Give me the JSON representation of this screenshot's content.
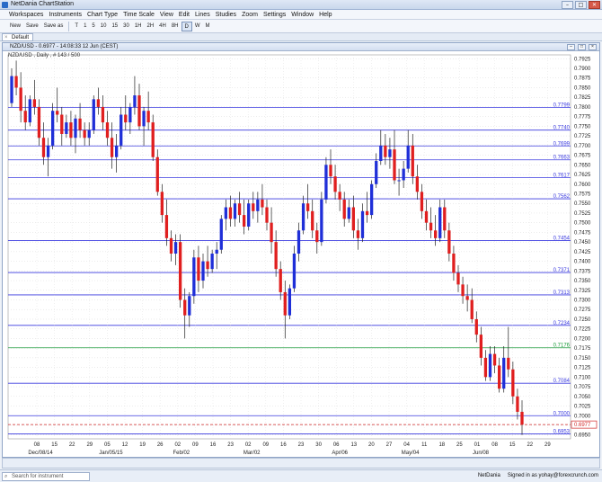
{
  "window": {
    "title": "NetDania ChartStation"
  },
  "menu": [
    "Workspaces",
    "Instruments",
    "Chart Type",
    "Time Scale",
    "View",
    "Edit",
    "Lines",
    "Studies",
    "Zoom",
    "Settings",
    "Window",
    "Help"
  ],
  "toolbar": {
    "buttons": [
      "New",
      "Save",
      "Save as"
    ],
    "timescales": [
      "T",
      "1",
      "5",
      "10",
      "15",
      "30",
      "1H",
      "2H",
      "4H",
      "8H",
      "D",
      "W",
      "M"
    ],
    "selected_timescale": "D"
  },
  "tab": {
    "label": "Default"
  },
  "chart_window": {
    "title": "NZD/USD - 0.6977 - 14:08:33 12 Jun (CEST)",
    "subtitle": "NZD/USD , Daily , # 143 / 500"
  },
  "chart_data": {
    "type": "candlestick",
    "instrument": "NZD/USD",
    "ylim": [
      0.694,
      0.7935
    ],
    "y_ticks": [
      "0.7925",
      "0.7900",
      "0.7875",
      "0.7850",
      "0.7825",
      "0.7800",
      "0.7775",
      "0.7750",
      "0.7725",
      "0.7700",
      "0.7675",
      "0.7650",
      "0.7625",
      "0.7600",
      "0.7575",
      "0.7550",
      "0.7525",
      "0.7500",
      "0.7475",
      "0.7450",
      "0.7425",
      "0.7400",
      "0.7375",
      "0.7350",
      "0.7325",
      "0.7300",
      "0.7275",
      "0.7250",
      "0.7225",
      "0.7200",
      "0.7175",
      "0.7150",
      "0.7125",
      "0.7100",
      "0.7075",
      "0.7050",
      "0.7025",
      "0.7000",
      "0.6975",
      "0.6950"
    ],
    "x_ticks": [
      "08",
      "15",
      "22",
      "29",
      "05",
      "12",
      "19",
      "26",
      "02",
      "09",
      "16",
      "23",
      "02",
      "09",
      "16",
      "23",
      "30",
      "06",
      "13",
      "20",
      "27",
      "04",
      "11",
      "18",
      "25",
      "01",
      "08",
      "15",
      "22",
      "29"
    ],
    "x_month_labels": [
      {
        "after_tick": 0,
        "label": "Dec/08/14"
      },
      {
        "after_tick": 4,
        "label": "Jan/05/15"
      },
      {
        "after_tick": 8,
        "label": "Feb/02"
      },
      {
        "after_tick": 12,
        "label": "Mar/02"
      },
      {
        "after_tick": 17,
        "label": "Apr/06"
      },
      {
        "after_tick": 21,
        "label": "May/04"
      },
      {
        "after_tick": 25,
        "label": "Jun/08"
      }
    ],
    "h_lines": [
      {
        "value": 0.7799,
        "label": "0.7799",
        "color": "#3a3adf"
      },
      {
        "value": 0.774,
        "label": "0.7740",
        "color": "#3a3adf"
      },
      {
        "value": 0.7699,
        "label": "0.7699",
        "color": "#3a3adf"
      },
      {
        "value": 0.7663,
        "label": "0.7663",
        "color": "#3a3adf"
      },
      {
        "value": 0.7617,
        "label": "0.7617",
        "color": "#3a3adf"
      },
      {
        "value": 0.7562,
        "label": "0.7562",
        "color": "#3a3adf"
      },
      {
        "value": 0.7454,
        "label": "0.7454",
        "color": "#3a3adf"
      },
      {
        "value": 0.7371,
        "label": "0.7371",
        "color": "#3a3adf"
      },
      {
        "value": 0.7313,
        "label": "0.7313",
        "color": "#3a3adf"
      },
      {
        "value": 0.7234,
        "label": "0.7234",
        "color": "#3a3adf"
      },
      {
        "value": 0.7176,
        "label": "0.7176",
        "color": "#1a9a3a"
      },
      {
        "value": 0.7084,
        "label": "0.7084",
        "color": "#3a3adf"
      },
      {
        "value": 0.7,
        "label": "0.7000",
        "color": "#3a3adf"
      },
      {
        "value": 0.6953,
        "label": "0.6953",
        "color": "#3a3adf"
      }
    ],
    "last_price": {
      "value": 0.6977,
      "label": "0.6977",
      "color": "#d22a2a"
    },
    "colors": {
      "up": "#1f2fd8",
      "down": "#e01f1f",
      "grid": "#d9d9d9",
      "background": "#ffffff"
    },
    "candles": [
      [
        0.781,
        0.79,
        0.78,
        0.788
      ],
      [
        0.788,
        0.792,
        0.783,
        0.785
      ],
      [
        0.785,
        0.789,
        0.776,
        0.779
      ],
      [
        0.779,
        0.783,
        0.774,
        0.776
      ],
      [
        0.776,
        0.783,
        0.775,
        0.782
      ],
      [
        0.782,
        0.787,
        0.778,
        0.78
      ],
      [
        0.78,
        0.782,
        0.77,
        0.772
      ],
      [
        0.772,
        0.776,
        0.765,
        0.767
      ],
      [
        0.767,
        0.772,
        0.762,
        0.77
      ],
      [
        0.77,
        0.781,
        0.769,
        0.779
      ],
      [
        0.779,
        0.785,
        0.776,
        0.778
      ],
      [
        0.778,
        0.78,
        0.77,
        0.773
      ],
      [
        0.773,
        0.778,
        0.772,
        0.776
      ],
      [
        0.776,
        0.779,
        0.77,
        0.772
      ],
      [
        0.772,
        0.778,
        0.768,
        0.777
      ],
      [
        0.777,
        0.781,
        0.772,
        0.774
      ],
      [
        0.774,
        0.776,
        0.77,
        0.772
      ],
      [
        0.772,
        0.776,
        0.77,
        0.774
      ],
      [
        0.774,
        0.783,
        0.773,
        0.782
      ],
      [
        0.782,
        0.785,
        0.778,
        0.78
      ],
      [
        0.78,
        0.783,
        0.774,
        0.776
      ],
      [
        0.776,
        0.779,
        0.77,
        0.772
      ],
      [
        0.772,
        0.776,
        0.764,
        0.767
      ],
      [
        0.767,
        0.773,
        0.763,
        0.77
      ],
      [
        0.77,
        0.78,
        0.769,
        0.778
      ],
      [
        0.778,
        0.783,
        0.774,
        0.776
      ],
      [
        0.776,
        0.781,
        0.773,
        0.78
      ],
      [
        0.78,
        0.788,
        0.778,
        0.783
      ],
      [
        0.783,
        0.786,
        0.774,
        0.775
      ],
      [
        0.775,
        0.78,
        0.77,
        0.779
      ],
      [
        0.779,
        0.784,
        0.774,
        0.776
      ],
      [
        0.776,
        0.778,
        0.766,
        0.767
      ],
      [
        0.767,
        0.769,
        0.757,
        0.758
      ],
      [
        0.758,
        0.76,
        0.75,
        0.752
      ],
      [
        0.752,
        0.756,
        0.744,
        0.746
      ],
      [
        0.746,
        0.748,
        0.74,
        0.742
      ],
      [
        0.742,
        0.747,
        0.739,
        0.745
      ],
      [
        0.745,
        0.747,
        0.728,
        0.73
      ],
      [
        0.73,
        0.733,
        0.72,
        0.726
      ],
      [
        0.726,
        0.732,
        0.723,
        0.731
      ],
      [
        0.731,
        0.743,
        0.729,
        0.741
      ],
      [
        0.741,
        0.744,
        0.732,
        0.735
      ],
      [
        0.735,
        0.742,
        0.733,
        0.74
      ],
      [
        0.74,
        0.744,
        0.736,
        0.738
      ],
      [
        0.738,
        0.743,
        0.737,
        0.742
      ],
      [
        0.742,
        0.745,
        0.738,
        0.743
      ],
      [
        0.743,
        0.752,
        0.742,
        0.751
      ],
      [
        0.751,
        0.756,
        0.748,
        0.754
      ],
      [
        0.754,
        0.757,
        0.749,
        0.751
      ],
      [
        0.751,
        0.756,
        0.749,
        0.755
      ],
      [
        0.755,
        0.758,
        0.75,
        0.752
      ],
      [
        0.752,
        0.756,
        0.747,
        0.749
      ],
      [
        0.749,
        0.756,
        0.748,
        0.755
      ],
      [
        0.755,
        0.758,
        0.751,
        0.753
      ],
      [
        0.753,
        0.758,
        0.75,
        0.756
      ],
      [
        0.756,
        0.76,
        0.752,
        0.754
      ],
      [
        0.754,
        0.756,
        0.748,
        0.75
      ],
      [
        0.75,
        0.754,
        0.742,
        0.745
      ],
      [
        0.745,
        0.748,
        0.736,
        0.738
      ],
      [
        0.738,
        0.74,
        0.73,
        0.732
      ],
      [
        0.732,
        0.735,
        0.72,
        0.726
      ],
      [
        0.726,
        0.734,
        0.725,
        0.733
      ],
      [
        0.733,
        0.744,
        0.732,
        0.742
      ],
      [
        0.742,
        0.75,
        0.74,
        0.748
      ],
      [
        0.748,
        0.757,
        0.747,
        0.755
      ],
      [
        0.755,
        0.76,
        0.751,
        0.753
      ],
      [
        0.753,
        0.756,
        0.746,
        0.748
      ],
      [
        0.748,
        0.75,
        0.742,
        0.745
      ],
      [
        0.745,
        0.758,
        0.744,
        0.756
      ],
      [
        0.756,
        0.767,
        0.755,
        0.765
      ],
      [
        0.765,
        0.769,
        0.76,
        0.762
      ],
      [
        0.762,
        0.765,
        0.756,
        0.758
      ],
      [
        0.758,
        0.76,
        0.753,
        0.756
      ],
      [
        0.756,
        0.758,
        0.749,
        0.751
      ],
      [
        0.751,
        0.756,
        0.75,
        0.754
      ],
      [
        0.754,
        0.757,
        0.746,
        0.748
      ],
      [
        0.748,
        0.751,
        0.743,
        0.746
      ],
      [
        0.746,
        0.755,
        0.745,
        0.753
      ],
      [
        0.753,
        0.758,
        0.75,
        0.752
      ],
      [
        0.752,
        0.761,
        0.751,
        0.76
      ],
      [
        0.76,
        0.768,
        0.759,
        0.766
      ],
      [
        0.766,
        0.774,
        0.765,
        0.77
      ],
      [
        0.77,
        0.773,
        0.765,
        0.767
      ],
      [
        0.767,
        0.772,
        0.764,
        0.769
      ],
      [
        0.769,
        0.774,
        0.76,
        0.761
      ],
      [
        0.761,
        0.764,
        0.757,
        0.761
      ],
      [
        0.761,
        0.766,
        0.759,
        0.764
      ],
      [
        0.764,
        0.774,
        0.763,
        0.77
      ],
      [
        0.77,
        0.773,
        0.76,
        0.762
      ],
      [
        0.762,
        0.765,
        0.756,
        0.758
      ],
      [
        0.758,
        0.76,
        0.751,
        0.753
      ],
      [
        0.753,
        0.756,
        0.748,
        0.75
      ],
      [
        0.75,
        0.754,
        0.746,
        0.748
      ],
      [
        0.748,
        0.752,
        0.744,
        0.746
      ],
      [
        0.746,
        0.756,
        0.745,
        0.754
      ],
      [
        0.754,
        0.756,
        0.746,
        0.748
      ],
      [
        0.748,
        0.75,
        0.74,
        0.742
      ],
      [
        0.742,
        0.744,
        0.735,
        0.737
      ],
      [
        0.737,
        0.739,
        0.732,
        0.734
      ],
      [
        0.734,
        0.736,
        0.729,
        0.731
      ],
      [
        0.731,
        0.734,
        0.727,
        0.73
      ],
      [
        0.73,
        0.733,
        0.724,
        0.725
      ],
      [
        0.725,
        0.727,
        0.719,
        0.721
      ],
      [
        0.721,
        0.723,
        0.713,
        0.715
      ],
      [
        0.715,
        0.717,
        0.709,
        0.71
      ],
      [
        0.71,
        0.718,
        0.709,
        0.716
      ],
      [
        0.716,
        0.718,
        0.711,
        0.713
      ],
      [
        0.713,
        0.715,
        0.706,
        0.707
      ],
      [
        0.707,
        0.718,
        0.706,
        0.715
      ],
      [
        0.715,
        0.723,
        0.71,
        0.712
      ],
      [
        0.712,
        0.714,
        0.703,
        0.705
      ],
      [
        0.705,
        0.707,
        0.699,
        0.701
      ],
      [
        0.701,
        0.704,
        0.695,
        0.6977
      ]
    ]
  },
  "status": {
    "search_placeholder": "Search for instrument",
    "brand": "NetDania",
    "signed_in": "Signed in as yohay@forexcrunch.com"
  }
}
